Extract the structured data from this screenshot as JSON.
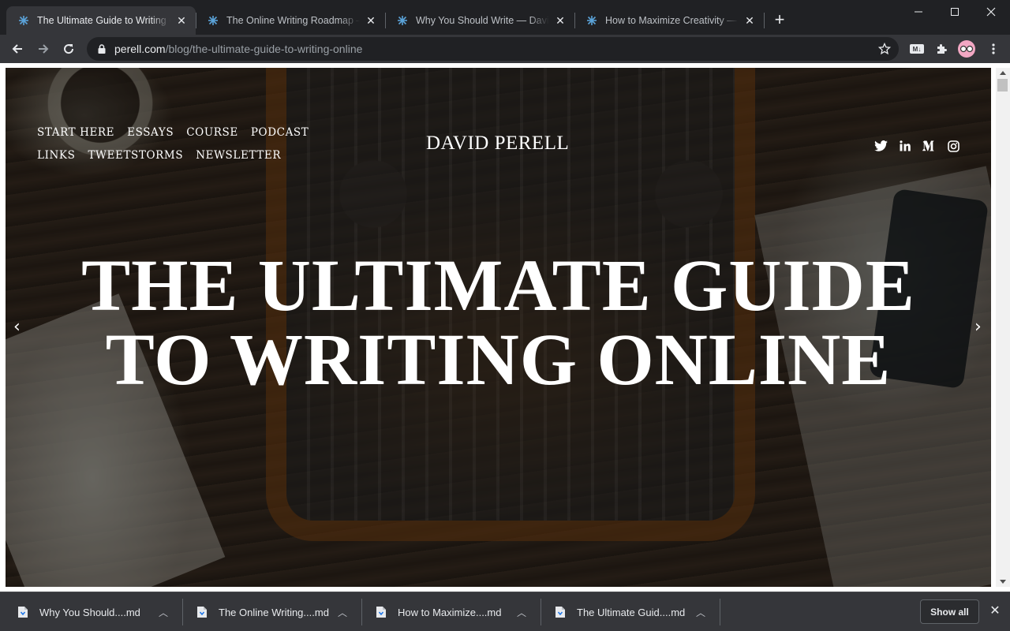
{
  "browser": {
    "tabs": [
      {
        "title": "The Ultimate Guide to Writing Online — David Perell",
        "active": true
      },
      {
        "title": "The Online Writing Roadmap — David Perell",
        "active": false
      },
      {
        "title": "Why You Should Write — David Perell",
        "active": false
      },
      {
        "title": "How to Maximize Creativity — David Perell",
        "active": false
      }
    ],
    "new_tab_label": "+",
    "address": {
      "host": "perell.com",
      "path": "/blog/the-ultimate-guide-to-writing-online"
    },
    "md_badge": "M↓",
    "profile_icon": "glasses-avatar-icon"
  },
  "site": {
    "nav_items": [
      "START HERE",
      "ESSAYS",
      "COURSE",
      "PODCAST",
      "LINKS",
      "TWEETSTORMS",
      "NEWSLETTER"
    ],
    "logo": "DAVID PERELL",
    "social_icons": [
      "twitter-icon",
      "linkedin-icon",
      "medium-icon",
      "instagram-icon"
    ],
    "hero_title_line1": "THE ULTIMATE GUIDE",
    "hero_title_line2": "TO WRITING ONLINE",
    "prev_arrow": "‹",
    "next_arrow": "›"
  },
  "downloads": {
    "items": [
      {
        "name": "Why You Should....md"
      },
      {
        "name": "The Online Writing....md"
      },
      {
        "name": "How to Maximize....md"
      },
      {
        "name": "The Ultimate Guid....md"
      }
    ],
    "show_all_label": "Show all"
  },
  "colors": {
    "browser_frame": "#202124",
    "toolbar": "#35363a",
    "favicon_accent": "#5ba3d9"
  }
}
